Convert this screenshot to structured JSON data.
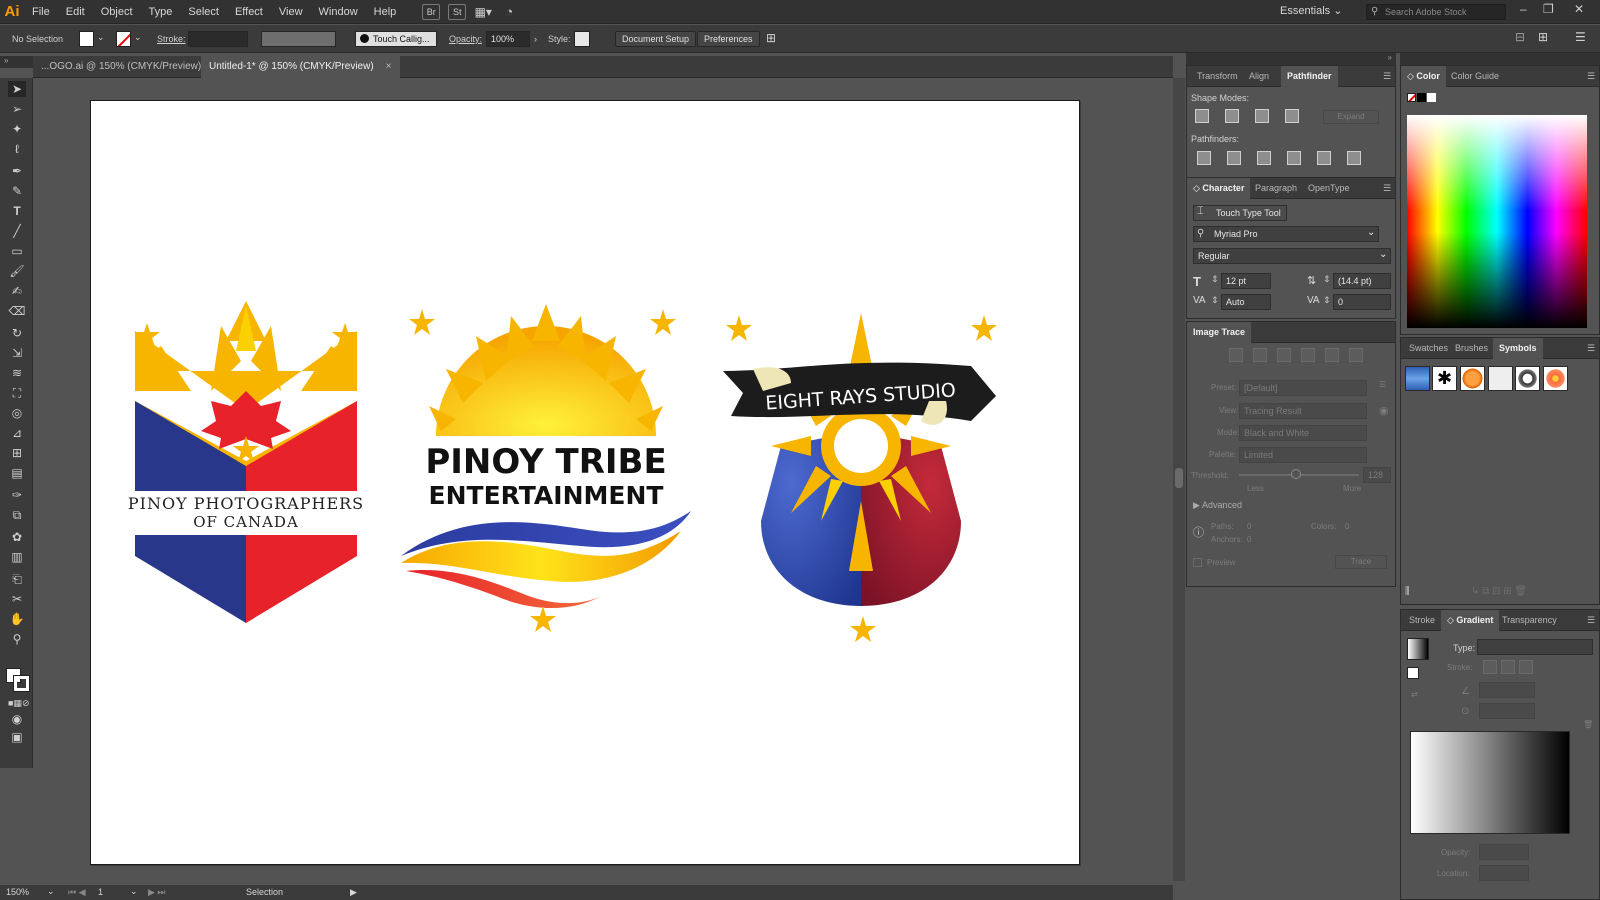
{
  "app": {
    "logo": "Ai"
  },
  "menu": [
    "File",
    "Edit",
    "Object",
    "Type",
    "Select",
    "Effect",
    "View",
    "Window",
    "Help"
  ],
  "menubar_icons": {
    "bridge": "Br",
    "stock": "St"
  },
  "workspace": {
    "label": "Essentials",
    "search_placeholder": "Search Adobe Stock"
  },
  "control": {
    "selection": "No Selection",
    "stroke_label": "Stroke:",
    "brush": "Touch Callig...",
    "opacity_label": "Opacity:",
    "opacity_value": "100%",
    "style_label": "Style:",
    "document_setup": "Document Setup",
    "preferences": "Preferences"
  },
  "tabs": [
    {
      "label": "...OGO.ai @ 150% (CMYK/Preview)"
    },
    {
      "label": "Untitled-1* @ 150% (CMYK/Preview)"
    }
  ],
  "status": {
    "zoom": "150%",
    "page": "1",
    "tool": "Selection"
  },
  "pathfinder_panel": {
    "tabs": [
      "Transform",
      "Align",
      "Pathfinder"
    ],
    "shape_modes": "Shape Modes:",
    "expand": "Expand",
    "pathfinders": "Pathfinders:"
  },
  "character_panel": {
    "tabs": [
      "Character",
      "Paragraph",
      "OpenType"
    ],
    "touch_type": "Touch Type Tool",
    "font": "Myriad Pro",
    "style": "Regular",
    "size": "12 pt",
    "leading": "(14.4 pt)",
    "kerning": "Auto",
    "tracking": "0"
  },
  "image_trace": {
    "title": "Image Trace",
    "preset_label": "Preset:",
    "preset": "[Default]",
    "view_label": "View:",
    "view": "Tracing Result",
    "mode_label": "Mode:",
    "mode": "Black and White",
    "palette_label": "Palette:",
    "palette": "Limited",
    "threshold_label": "Threshold:",
    "threshold": "128",
    "less": "Less",
    "more": "More",
    "advanced": "Advanced",
    "paths_label": "Paths:",
    "paths": "0",
    "colors_label": "Colors:",
    "colors": "0",
    "anchors_label": "Anchors:",
    "anchors": "0",
    "preview": "Preview",
    "trace": "Trace"
  },
  "color_panel": {
    "tabs": [
      "Color",
      "Color Guide"
    ]
  },
  "symbols_panel": {
    "tabs": [
      "Swatches",
      "Brushes",
      "Symbols"
    ]
  },
  "gradient_panel": {
    "tabs": [
      "Stroke",
      "Gradient",
      "Transparency"
    ],
    "type_label": "Type:",
    "stroke_label": "Stroke:",
    "opacity_label": "Opacity:",
    "location_label": "Location:"
  },
  "artwork": {
    "logo1_line1": "PINOY PHOTOGRAPHERS",
    "logo1_line2": "OF CANADA",
    "logo2_line1": "PINOY TRIBE",
    "logo2_line2": "ENTERTAINMENT",
    "logo3_banner": "EIGHT RAYS STUDIO"
  },
  "colors": {
    "accent_orange": "#ff9a00",
    "sun_yellow": "#f7b500",
    "flag_blue": "#28378a",
    "flag_red": "#e8222a"
  }
}
